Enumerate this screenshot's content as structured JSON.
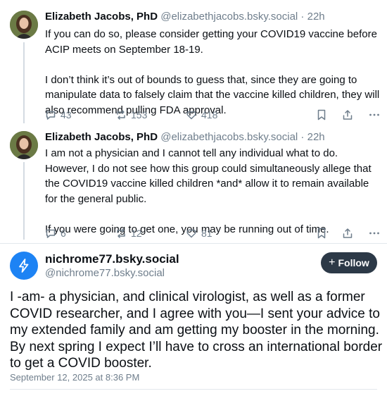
{
  "posts": [
    {
      "author_name": "Elizabeth Jacobs, PhD",
      "handle": "@elizabethjacobs.bsky.social",
      "time": " · 22h",
      "paragraphs": [
        "If you can do so, please consider getting your COVID19 vaccine before ACIP meets on September 18-19.",
        "I don’t think it’s out of bounds to guess that, since they are going to manipulate data to falsely claim that the vaccine killed children, they will also recommend pulling FDA approval."
      ],
      "replies": "43",
      "reposts": "153",
      "likes": "418"
    },
    {
      "author_name": "Elizabeth Jacobs, PhD",
      "handle": "@elizabethjacobs.bsky.social",
      "time": " · 22h",
      "paragraphs": [
        "I am not a physician and I cannot tell any individual what to do. However, I do not see how this group could simultaneously allege that the COVID19 vaccine killed children *and* allow it to remain available for the general public.",
        "If you were going to get one, you may be running out of time."
      ],
      "replies": "6",
      "reposts": "12",
      "likes": "81"
    }
  ],
  "main": {
    "display_name": "nichrome77.bsky.social",
    "handle": "@nichrome77.bsky.social",
    "follow_label": "Follow",
    "text": "I -am- a physician, and clinical virologist, as well as a former COVID researcher, and I agree with you—I sent your advice to my extended family and am getting my booster in the morning. By next spring I expect I’ll have to cross an international border to get a COVID booster.",
    "date": "September 12, 2025 at 8:36 PM"
  },
  "colors": {
    "accent": "#1d83f4",
    "muted": "#6f7e8c",
    "follow_bg": "#2c3947"
  },
  "icons": [
    "reply-icon",
    "repost-icon",
    "like-icon",
    "bookmark-icon",
    "share-icon",
    "more-icon",
    "lightning-icon",
    "plus-icon"
  ]
}
